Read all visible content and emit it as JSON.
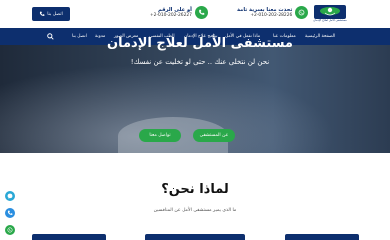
{
  "header": {
    "call_button": "اتصل بنا",
    "contact_primary": {
      "title": "تحدث معنا بسرية تامة",
      "phone": "+2-010-202-28226"
    },
    "contact_secondary": {
      "title": "أو على الرقم",
      "phone": "+2-010-202-26227"
    },
    "logo_caption": "مستشفى الأمل لعلاج الإدمان"
  },
  "nav": {
    "items": [
      "الصفحة الرئيسية",
      "معلومات عنا",
      "ماذا تفعل في الأمل",
      "برامج علاج الإدمان",
      "الطب النفسي",
      "معرض الصور",
      "مدونة",
      "اتصل بنا"
    ]
  },
  "hero": {
    "title": "مستشفى الأمل لعلاج الإدمان",
    "subtitle": "نحن لن نتخلى عنك .. حتى لو تخليت عن نفسك!",
    "primary_button": "عن المستشفى",
    "secondary_button": "تواصل معنا"
  },
  "why": {
    "title": "لماذا نحن؟",
    "subtitle": "ما الذي يميز مستشفى الأمل عن المنافسين"
  },
  "colors": {
    "brand": "#0d2f6e",
    "accent": "#2aa84a"
  },
  "icons": [
    "phone-icon",
    "whatsapp-icon",
    "search-icon",
    "messenger-icon"
  ]
}
